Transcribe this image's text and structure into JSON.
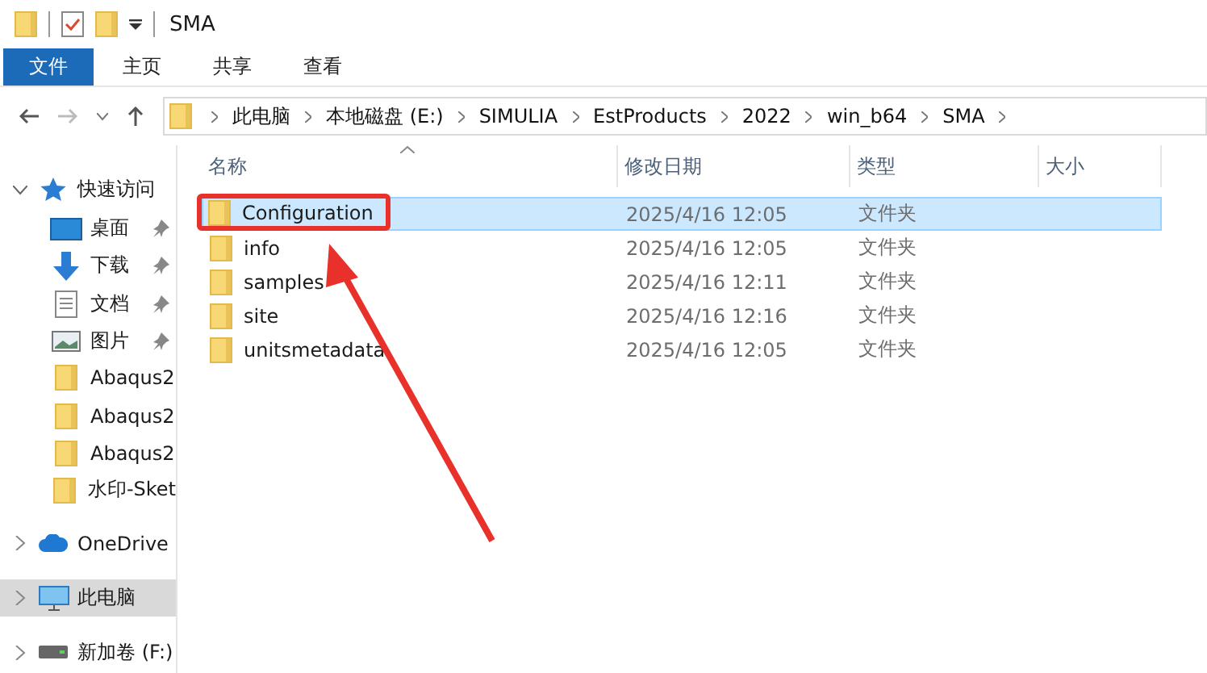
{
  "title_bar": {
    "title": "SMA"
  },
  "ribbon_tabs": [
    {
      "label": "文件",
      "selected": true
    },
    {
      "label": "主页",
      "selected": false
    },
    {
      "label": "共享",
      "selected": false
    },
    {
      "label": "查看",
      "selected": false
    }
  ],
  "address_bar": {
    "path": [
      "此电脑",
      "本地磁盘 (E:)",
      "SIMULIA",
      "EstProducts",
      "2022",
      "win_b64",
      "SMA"
    ]
  },
  "sidebar": [
    {
      "label": "快速访问",
      "kind": "star",
      "expanded": true,
      "selected": false,
      "children": [
        {
          "label": "桌面",
          "kind": "desktop",
          "pinned": true
        },
        {
          "label": "下载",
          "kind": "download",
          "pinned": true
        },
        {
          "label": "文档",
          "kind": "document",
          "pinned": true
        },
        {
          "label": "图片",
          "kind": "picture",
          "pinned": true
        },
        {
          "label": "Abaqus2",
          "kind": "folder",
          "pinned": false
        },
        {
          "label": "Abaqus2",
          "kind": "folder",
          "pinned": false
        },
        {
          "label": "Abaqus2",
          "kind": "folder",
          "pinned": false
        },
        {
          "label": "水印-Sket",
          "kind": "folder",
          "pinned": false
        }
      ]
    },
    {
      "label": "OneDrive",
      "kind": "cloud",
      "expanded": false,
      "selected": false
    },
    {
      "label": "此电脑",
      "kind": "computer",
      "expanded": false,
      "selected": true
    },
    {
      "label": "新加卷 (F:)",
      "kind": "drive",
      "expanded": false,
      "selected": false
    }
  ],
  "file_list": {
    "columns": [
      "名称",
      "修改日期",
      "类型",
      "大小"
    ],
    "rows": [
      {
        "name": "Configuration",
        "modified": "2025/4/16 12:05",
        "type": "文件夹",
        "selected": true,
        "highlighted": true
      },
      {
        "name": "info",
        "modified": "2025/4/16 12:05",
        "type": "文件夹",
        "selected": false,
        "highlighted": false
      },
      {
        "name": "samples",
        "modified": "2025/4/16 12:11",
        "type": "文件夹",
        "selected": false,
        "highlighted": false
      },
      {
        "name": "site",
        "modified": "2025/4/16 12:16",
        "type": "文件夹",
        "selected": false,
        "highlighted": false
      },
      {
        "name": "unitsmetadata",
        "modified": "2025/4/16 12:05",
        "type": "文件夹",
        "selected": false,
        "highlighted": false
      }
    ]
  },
  "annotations": [
    {
      "kind": "arrow"
    }
  ]
}
